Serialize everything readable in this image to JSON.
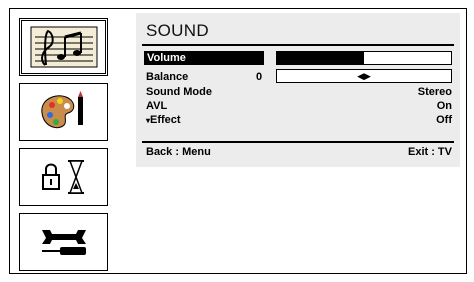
{
  "menu": {
    "title": "SOUND",
    "items": [
      {
        "label": "Volume",
        "value": "",
        "level": 0.5
      },
      {
        "label": "Balance",
        "value": "0"
      },
      {
        "label": "Sound Mode",
        "value": "Stereo"
      },
      {
        "label": "AVL",
        "value": "On"
      },
      {
        "label": "Effect",
        "value": "Off",
        "prefix": "▾"
      }
    ],
    "footer": {
      "back": "Back : Menu",
      "exit": "Exit : TV"
    }
  },
  "sidebar": {
    "items": [
      {
        "icon": "music-notes-icon",
        "selected": true
      },
      {
        "icon": "paint-palette-icon",
        "selected": false
      },
      {
        "icon": "lock-timer-icon",
        "selected": false
      },
      {
        "icon": "wrench-screwdriver-icon",
        "selected": false
      }
    ]
  },
  "colors": {
    "panel_bg": "#ececec",
    "highlight": "#000000"
  }
}
